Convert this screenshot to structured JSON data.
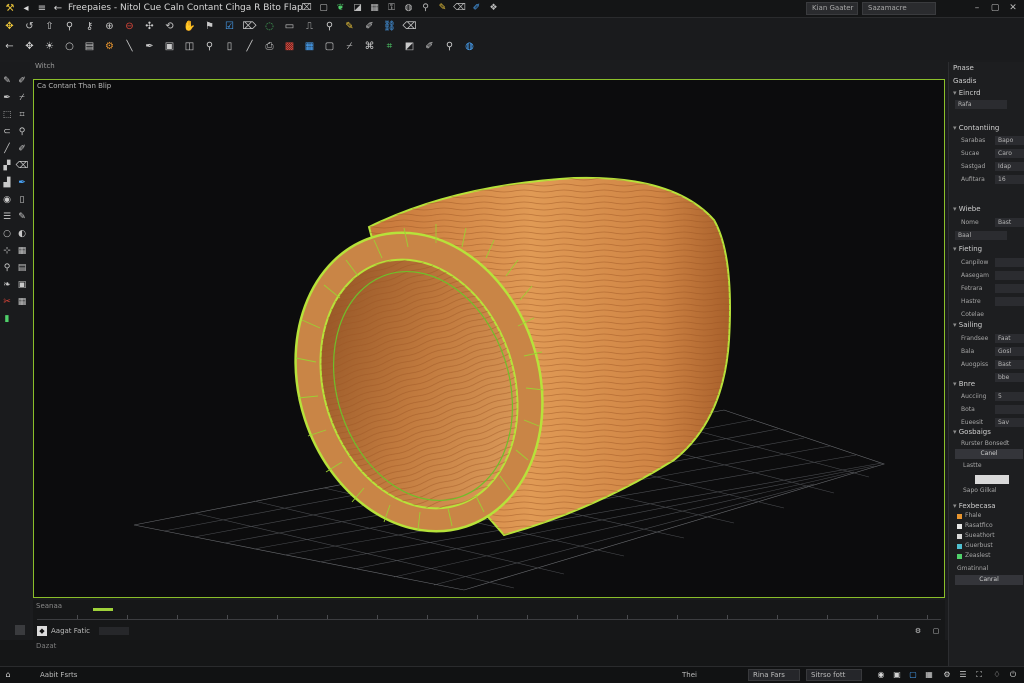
{
  "titlebar": {
    "app_title": "Freepaies - Nitol Cue Caln Contant Cihga R Bito Flap",
    "workspace_a": "Kian Gaater",
    "workspace_b": "Sazamacre",
    "icons": [
      "hammer-icon",
      "square-icon",
      "bars-icon",
      "snowflake-icon",
      "arrow-icon"
    ]
  },
  "toolbar": {
    "row1": [
      "pointer-icon",
      "lasso-icon",
      "arrow-up-icon",
      "magnify-icon",
      "key-icon",
      "zoom-icon",
      "zoom-minus-icon",
      "move-icon",
      "rotate-icon",
      "pan-icon",
      "flag-icon",
      "checkbox-icon",
      "trash-icon",
      "ring-icon",
      "rubber-icon",
      "pipe-icon",
      "search-icon",
      "marker-icon",
      "brush-icon",
      "link-icon",
      "eraser-icon"
    ],
    "row2": [
      "back-icon",
      "move-icon",
      "light-icon",
      "circle-icon",
      "book-icon",
      "gear-icon",
      "lamp-icon",
      "pen-icon",
      "stack-icon",
      "window-icon",
      "search-icon",
      "file-icon",
      "line-icon",
      "camera-icon",
      "scale-icon",
      "table-icon",
      "box-icon",
      "knife-icon",
      "node-icon",
      "mesh-icon",
      "box-icon",
      "brush-icon",
      "search-icon",
      "globe-icon"
    ]
  },
  "leftbar": {
    "tools": [
      "pencil-icon",
      "brush-icon",
      "pen-icon",
      "knife-icon",
      "select-icon",
      "crop-icon",
      "magnet-icon",
      "zoom-icon",
      "knife-icon",
      "brush-icon",
      "paint-icon",
      "eraser-icon",
      "bucket-icon",
      "pen-icon",
      "eye-icon",
      "page-icon",
      "layers-icon",
      "link-icon",
      "circle-icon",
      "face-icon",
      "crosshair-icon",
      "grid-icon",
      "pin-icon",
      "grid-icon",
      "leaf-icon",
      "stack-icon",
      "scissors-icon",
      "grid-icon",
      "check-icon"
    ]
  },
  "viewport": {
    "tab": "Witch",
    "label": "Ca Contant Than Blip"
  },
  "timeline": {
    "label": "Seanaa",
    "track_name": "Aagat Fatic"
  },
  "lower": {
    "label": "Dazat"
  },
  "statusbar": {
    "left_text": "Aabit Fsrts",
    "mid_text": "Thei",
    "box_a": "Rina Fars",
    "box_b": "Sitrso fott"
  },
  "right_panel": {
    "header": "Pnase",
    "title": "Gasdis",
    "sections": [
      {
        "name": "Eincrd",
        "rows": [
          {
            "label": "Rafa",
            "value": ""
          }
        ]
      },
      {
        "name": "Contantiing",
        "rows": [
          {
            "label": "Sarabas",
            "value": "Bapo"
          },
          {
            "label": "Sucae",
            "value": "Caro"
          },
          {
            "label": "Sastgad",
            "value": "Idap"
          },
          {
            "label": "Aufitara",
            "value": "16"
          }
        ]
      },
      {
        "name": "Wiebe",
        "rows": [
          {
            "label": "Nome",
            "value": "Bast"
          },
          {
            "label": "Baal",
            "value": ""
          }
        ]
      },
      {
        "name": "Fieting",
        "rows": [
          {
            "label": "Canpilow",
            "value": ""
          },
          {
            "label": "Aasegam",
            "value": ""
          },
          {
            "label": "Fetrara",
            "value": ""
          },
          {
            "label": "Hastre",
            "value": ""
          },
          {
            "label": "Cotelae",
            "value": ""
          }
        ]
      },
      {
        "name": "Sailing",
        "rows": [
          {
            "label": "Frandsee",
            "value": "Faat"
          },
          {
            "label": "Bala",
            "value": "Gosl"
          },
          {
            "label": "Auogpiss",
            "value": "Bast"
          },
          {
            "label": "",
            "value": "bbe"
          }
        ]
      },
      {
        "name": "Bnre",
        "rows": [
          {
            "label": "Aucciing",
            "value": "5"
          },
          {
            "label": "Bota",
            "value": ""
          },
          {
            "label": "Eueesit",
            "value": "Sav"
          }
        ]
      },
      {
        "name": "Gosbaigs",
        "rows": [
          {
            "label": "Rurster Bonsedt",
            "value": ""
          }
        ]
      }
    ],
    "button_1": "Canel",
    "note": "Lastte",
    "textures_title": "Fexbecasa",
    "textures": [
      {
        "name": "Fhale",
        "color": "#e8952f"
      },
      {
        "name": "Rasatfico",
        "color": "#e8e8e8"
      },
      {
        "name": "Sueathort",
        "color": "#d8d8d8"
      },
      {
        "name": "Guerbust",
        "color": "#4fc0d0"
      },
      {
        "name": "Zeaslest",
        "color": "#4fd06a"
      }
    ],
    "extra_a": "Sapo Gilkal",
    "extra_b": "Gmatinnal",
    "button_2": "Canral"
  },
  "colors": {
    "accent": "#9fd23a",
    "wood": "#c97a3a",
    "viewport_bg": "#0c0c0d"
  }
}
